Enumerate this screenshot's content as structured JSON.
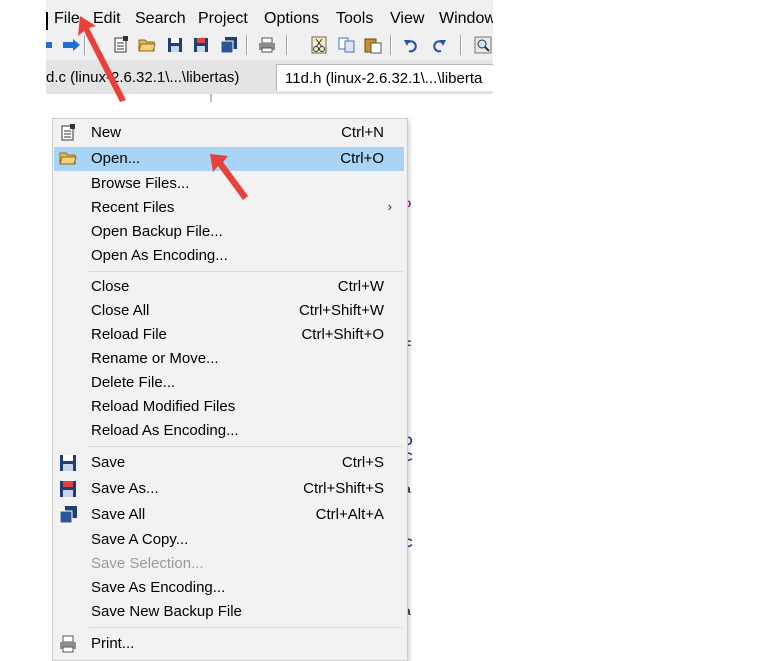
{
  "menubar": {
    "items": [
      {
        "label": "File"
      },
      {
        "label": "Edit"
      },
      {
        "label": "Search"
      },
      {
        "label": "Project"
      },
      {
        "label": "Options"
      },
      {
        "label": "Tools"
      },
      {
        "label": "View"
      },
      {
        "label": "Window"
      }
    ]
  },
  "toolbar": {
    "icons": [
      "back-arrow-icon",
      "forward-arrow-icon",
      "new-file-icon",
      "open-folder-icon",
      "save-icon",
      "save-as-icon",
      "save-all-icon",
      "print-icon",
      "cut-icon",
      "copy-icon",
      "paste-icon",
      "undo-icon",
      "redo-icon",
      "search-icon"
    ]
  },
  "tabs": [
    {
      "label": "d.c (linux-2.6.32.1\\...\\libertas)"
    },
    {
      "label": "11d.h (linux-2.6.32.1\\...\\liberta"
    }
  ],
  "file_menu": {
    "items": [
      {
        "label": "New",
        "shortcut": "Ctrl+N",
        "icon": "new-file-icon"
      },
      {
        "label": "Open...",
        "shortcut": "Ctrl+O",
        "icon": "open-folder-icon",
        "highlighted": true
      },
      {
        "label": "Browse Files...",
        "shortcut": ""
      },
      {
        "label": "Recent Files",
        "shortcut": "",
        "submenu": true
      },
      {
        "label": "Open Backup File...",
        "shortcut": ""
      },
      {
        "label": "Open As Encoding...",
        "shortcut": ""
      },
      {
        "label": "Close",
        "shortcut": "Ctrl+W"
      },
      {
        "label": "Close All",
        "shortcut": "Ctrl+Shift+W"
      },
      {
        "label": "Reload File",
        "shortcut": "Ctrl+Shift+O"
      },
      {
        "label": "Rename or Move...",
        "shortcut": ""
      },
      {
        "label": "Delete File...",
        "shortcut": ""
      },
      {
        "label": "Reload Modified Files",
        "shortcut": ""
      },
      {
        "label": "Reload As Encoding...",
        "shortcut": ""
      },
      {
        "label": "Save",
        "shortcut": "Ctrl+S",
        "icon": "save-icon"
      },
      {
        "label": "Save As...",
        "shortcut": "Ctrl+Shift+S",
        "icon": "save-as-icon"
      },
      {
        "label": "Save All",
        "shortcut": "Ctrl+Alt+A",
        "icon": "save-all-icon"
      },
      {
        "label": "Save A Copy...",
        "shortcut": ""
      },
      {
        "label": "Save Selection...",
        "shortcut": "",
        "disabled": true
      },
      {
        "label": "Save As Encoding...",
        "shortcut": ""
      },
      {
        "label": "Save New Backup File",
        "shortcut": ""
      },
      {
        "label": "Print...",
        "shortcut": "",
        "icon": "print-icon"
      }
    ],
    "submenu_arrow": "›"
  },
  "colors": {
    "highlight": "#a9d4f5",
    "annotation_arrow": "#e8403a",
    "menu_bg": "#f2f2f2"
  }
}
